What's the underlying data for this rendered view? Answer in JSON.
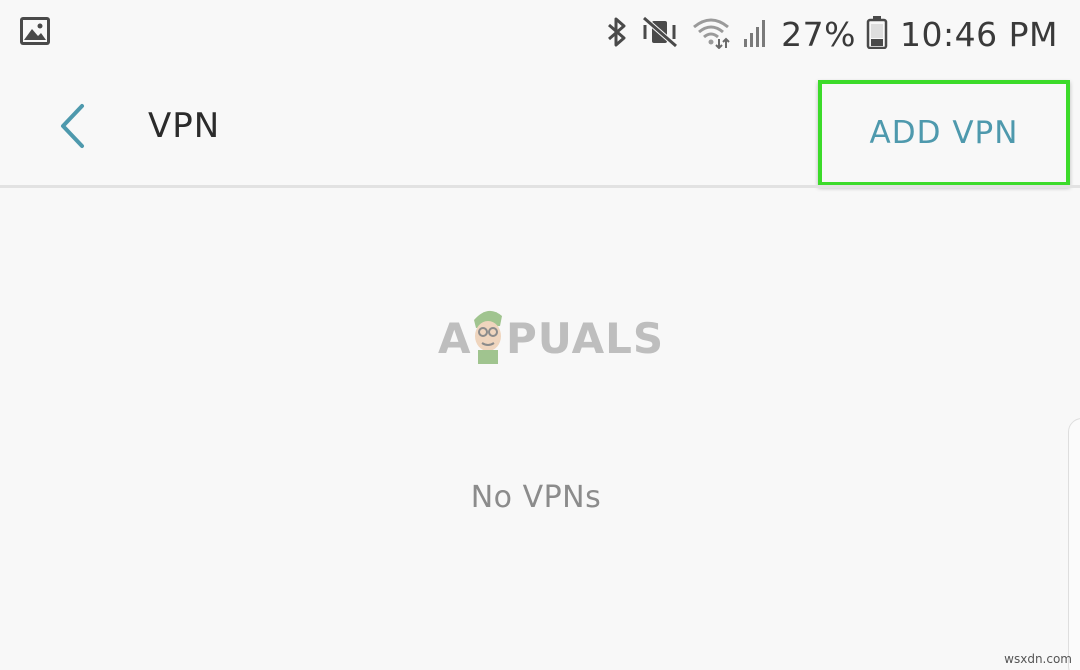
{
  "status_bar": {
    "battery_percent": "27%",
    "time": "10:46 PM",
    "icons": [
      "gallery-notification-icon",
      "bluetooth-icon",
      "vibrate-mute-icon",
      "wifi-icon",
      "cell-signal-icon",
      "battery-icon"
    ]
  },
  "toolbar": {
    "title": "VPN",
    "add_label": "ADD VPN",
    "back_icon": "chevron-left-icon",
    "accent_color": "#4e99ad",
    "highlight_color": "#3cdb2a"
  },
  "content": {
    "empty_message": "No VPNs"
  },
  "watermark": {
    "left": "A",
    "right": "PUALS"
  },
  "site_mark": "wsxdn.com"
}
